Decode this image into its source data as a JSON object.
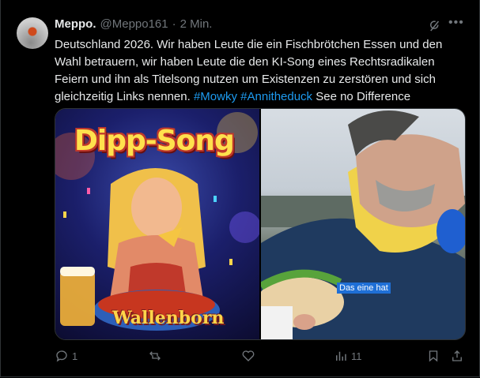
{
  "tweet": {
    "display_name": "Meppo.",
    "handle": "@Meppo161",
    "separator": "·",
    "time": "2 Min.",
    "more_icon": "more-icon",
    "text_main": "Deutschland 2026. Wir haben Leute die ein Fischbrötchen Essen und den Wahl betrauern, wir haben Leute die den KI-Song eines Rechtsradikalen Feiern und ihn als Titelsong nutzen um Existenzen zu zerstören und sich gleichzeitig Links nennen.",
    "hashtags": [
      "#Mowky",
      "#Annitheduck"
    ],
    "text_tail": "See no Difference"
  },
  "media": {
    "left_title": "Dipp-Song",
    "left_brand": "Wallenborn",
    "right_caption": "Das eine hat"
  },
  "actions": {
    "reply_count": "1",
    "retweet_count": "",
    "like_count": "",
    "views_count": "11"
  },
  "colors": {
    "background": "#000000",
    "text": "#e7e9ea",
    "muted": "#71767b",
    "link": "#1d9bf0",
    "border": "#2f3336"
  }
}
